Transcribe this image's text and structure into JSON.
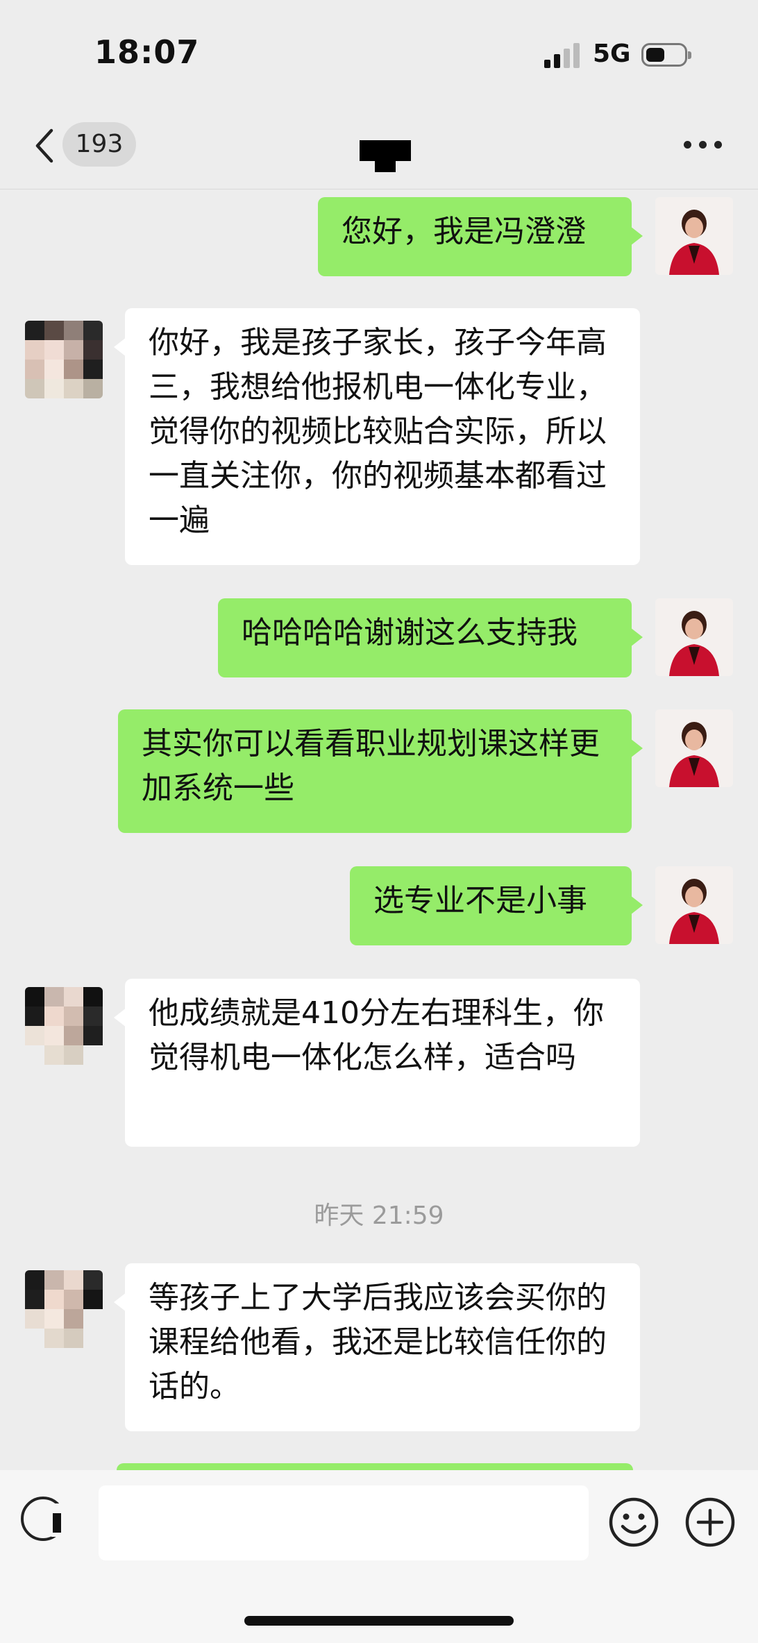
{
  "status_bar": {
    "time": "18:07",
    "network": "5G",
    "battery_level": 0.45
  },
  "header": {
    "unread_count": "193"
  },
  "messages": [
    {
      "sender": "me",
      "text": "您好，我是冯澄澄"
    },
    {
      "sender": "other",
      "text": "你好，我是孩子家长，孩子今年高三，我想给他报机电一体化专业，觉得你的视频比较贴合实际，所以一直关注你，你的视频基本都看过一遍"
    },
    {
      "sender": "me",
      "text": "哈哈哈哈谢谢这么支持我"
    },
    {
      "sender": "me",
      "text": "其实你可以看看职业规划课这样更加系统一些"
    },
    {
      "sender": "me",
      "text": "选专业不是小事"
    },
    {
      "sender": "other",
      "text": "他成绩就是410分左右理科生，你觉得机电一体化怎么样，适合吗"
    },
    {
      "sender": "other",
      "text": "等孩子上了大学后我应该会买你的课程给他看，我还是比较信任你的话的。"
    }
  ],
  "timestamp": "昨天 21:59",
  "input_bar": {
    "message_input_value": ""
  },
  "colors": {
    "my_bubble": "#95ec69",
    "other_bubble": "#ffffff",
    "background": "#ededed"
  },
  "icons": [
    "back-chevron-icon",
    "more-icon",
    "voice-icon",
    "emoji-icon",
    "plus-icon"
  ]
}
